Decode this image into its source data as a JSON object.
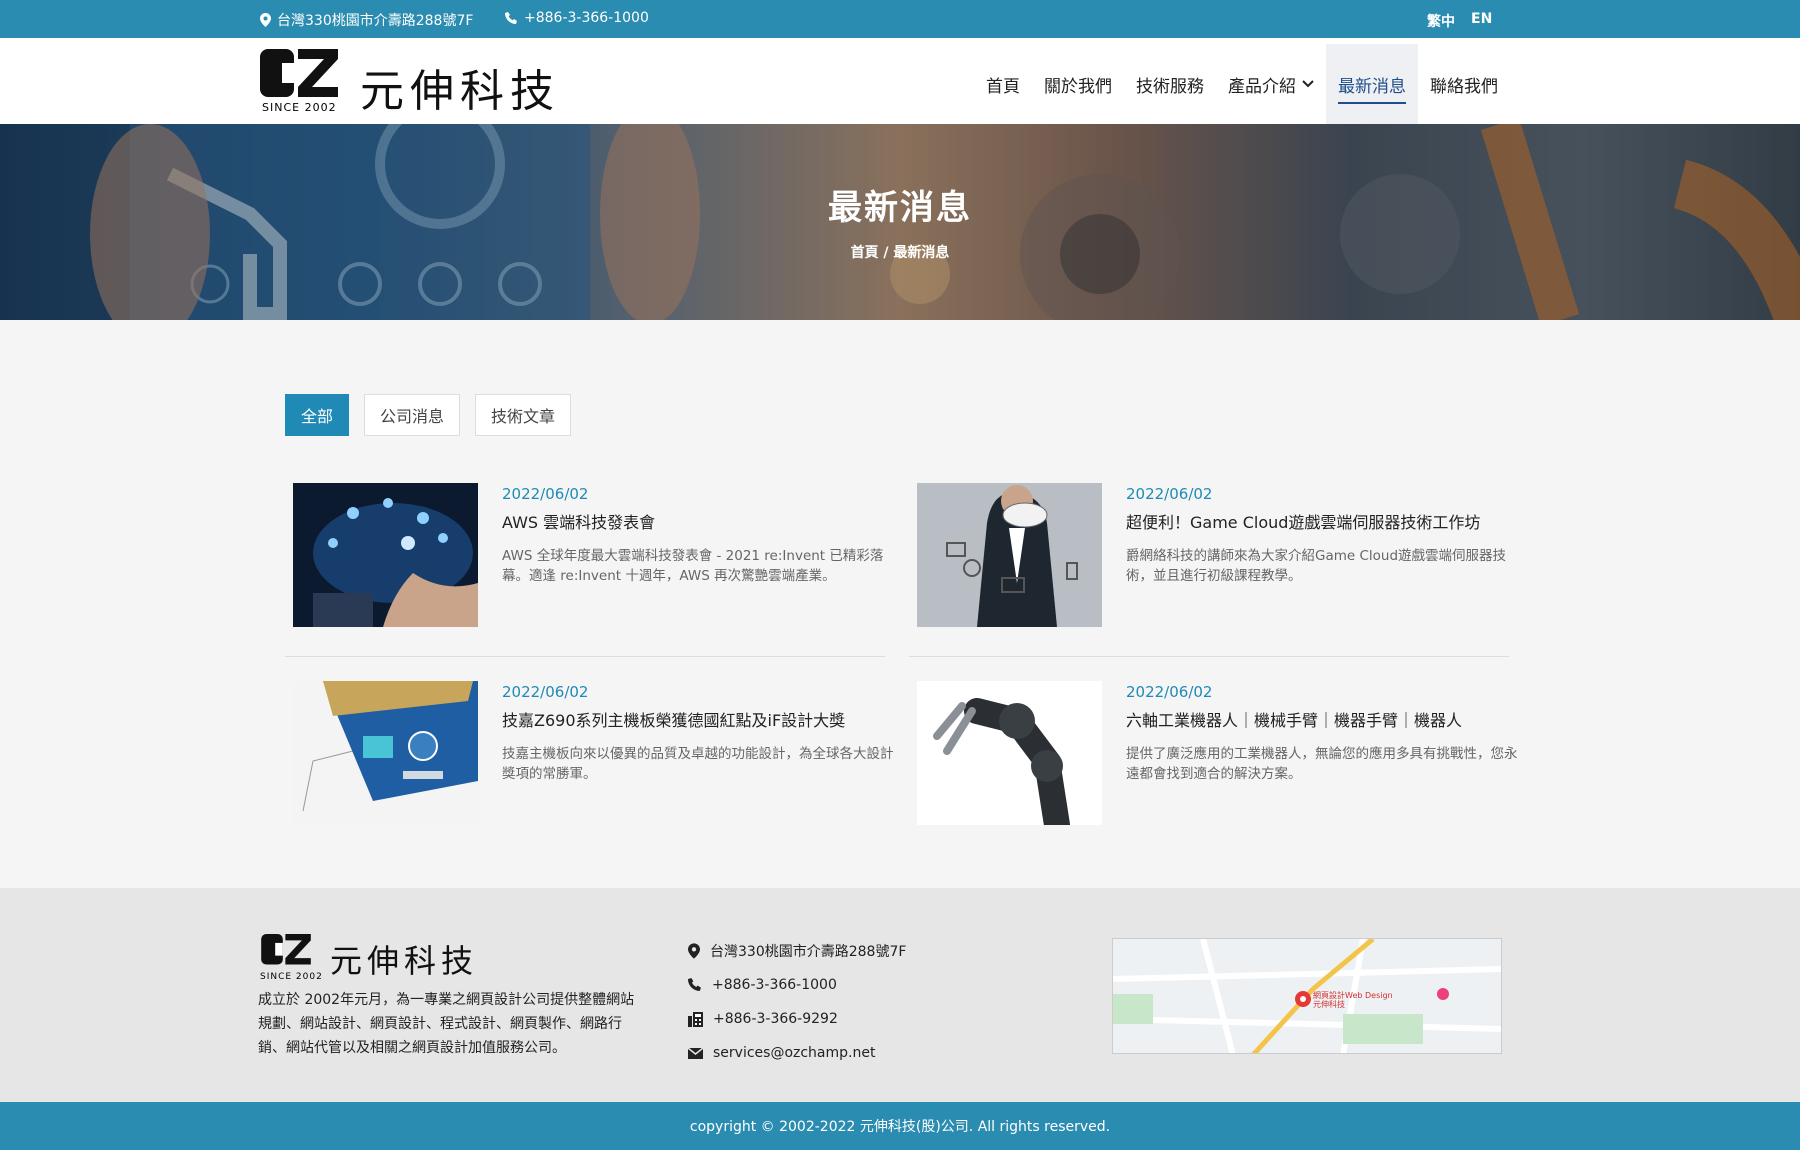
{
  "topbar": {
    "address": "台灣330桃園市介壽路288號7F",
    "phone": "+886-3-366-1000",
    "lang_zh": "繁中",
    "lang_en": "EN"
  },
  "header": {
    "logo_name": "元伸科技",
    "logo_since": "SINCE 2002"
  },
  "nav": {
    "home": "首頁",
    "about": "關於我們",
    "services": "技術服務",
    "products": "產品介紹",
    "news": "最新消息",
    "contact": "聯絡我們"
  },
  "banner": {
    "title": "最新消息",
    "breadcrumb": "首頁 / 最新消息"
  },
  "filters": {
    "all": "全部",
    "company": "公司消息",
    "tech": "技術文章"
  },
  "news": [
    {
      "date": "2022/06/02",
      "title": "AWS 雲端科技發表會",
      "desc": "AWS 全球年度最大雲端科技發表會 - 2021 re:Invent 已精彩落幕。適逢 re:Invent 十週年，AWS 再次驚艷雲端產業。"
    },
    {
      "date": "2022/06/02",
      "title": "超便利！Game Cloud遊戲雲端伺服器技術工作坊",
      "desc": "爵網絡科技的講師來為大家介紹Game Cloud遊戲雲端伺服器技術，並且進行初級課程教學。"
    },
    {
      "date": "2022/06/02",
      "title": "技嘉Z690系列主機板榮獲德國紅點及iF設計大獎",
      "desc": "技嘉主機板向來以優異的品質及卓越的功能設計，為全球各大設計獎項的常勝軍。"
    },
    {
      "date": "2022/06/02",
      "title": "六軸工業機器人｜機械手臂｜機器手臂｜機器人",
      "desc": "提供了廣泛應用的工業機器人，無論您的應用多具有挑戰性，您永遠都會找到適合的解決方案。"
    }
  ],
  "footer": {
    "logo_name": "元伸科技",
    "logo_since": "SINCE 2002",
    "desc": "成立於 2002年元月，為一專業之網頁設計公司提供整體網站規劃、網站設計、網頁設計、程式設計、網頁製作、網路行銷、網站代管以及相關之網頁設計加值服務公司。",
    "address": "台灣330桃園市介壽路288號7F",
    "phone": "+886-3-366-1000",
    "fax": "+886-3-366-9292",
    "email": "services@ozchamp.net",
    "map_pin": "網頁設計Web Design 元伸科技"
  },
  "copyright": "copyright © 2002-2022 元伸科技(股)公司. All rights reserved.",
  "colors": {
    "primary": "#2a8cb0",
    "accent": "#1f8ab5",
    "nav_active": "#1f4e8c"
  }
}
